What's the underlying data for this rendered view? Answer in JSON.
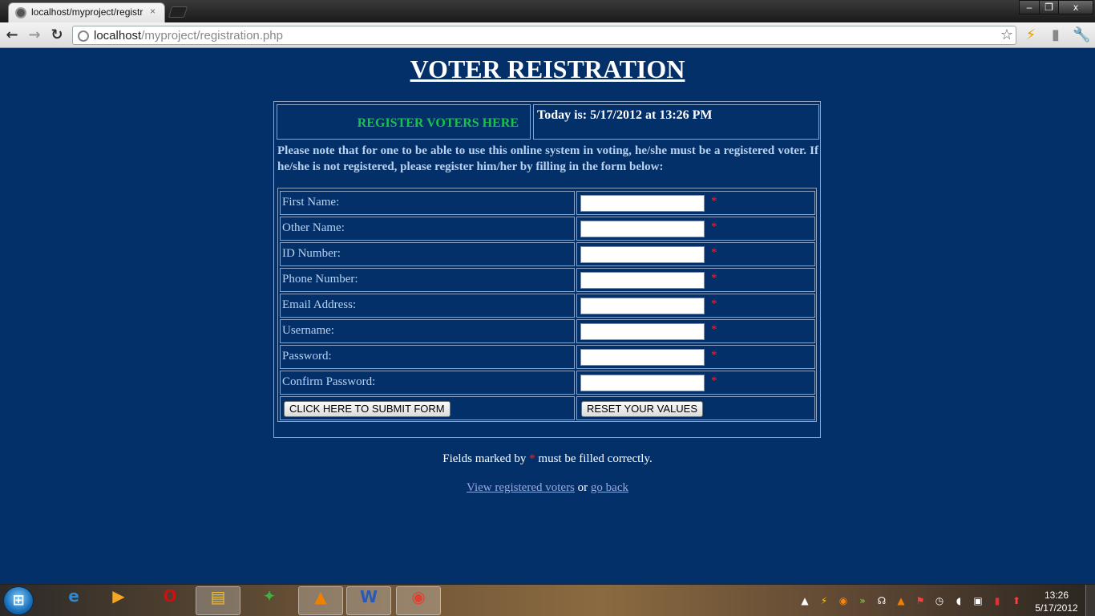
{
  "browser": {
    "tab_title": "localhost/myproject/registr",
    "tab_close": "×",
    "url_host": "localhost",
    "url_path": "/myproject/registration.php",
    "window_buttons": {
      "minimize": "–",
      "maximize": "❐",
      "close": "x"
    }
  },
  "page": {
    "title": "VOTER REISTRATION",
    "register_heading": "REGISTER VOTERS HERE",
    "date_text": "Today is: 5/17/2012 at 13:26 PM",
    "notice": "Please note that for one to be able to use this online system in voting, he/she must be a registered voter. If he/she is not registered, please register him/her by filling in the form below:",
    "fields": [
      {
        "label": "First Name:",
        "value": ""
      },
      {
        "label": "Other Name:",
        "value": ""
      },
      {
        "label": "ID Number:",
        "value": ""
      },
      {
        "label": "Phone Number:",
        "value": ""
      },
      {
        "label": "Email Address:",
        "value": ""
      },
      {
        "label": "Username:",
        "value": ""
      },
      {
        "label": "Password:",
        "value": ""
      },
      {
        "label": "Confirm Password:",
        "value": ""
      }
    ],
    "required_marker": "*",
    "submit_label": "CLICK HERE TO SUBMIT FORM",
    "reset_label": "RESET YOUR VALUES",
    "footnote_before": "Fields marked by",
    "footnote_after": "must be filled correctly.",
    "link_view": "View registered voters",
    "link_sep": "or",
    "link_back": "go back"
  },
  "taskbar": {
    "clock_time": "13:26",
    "clock_date": "5/17/2012"
  },
  "colors": {
    "page_bg": "#04306a",
    "heading_green": "#19c24d",
    "label_blue": "#b9d2ee",
    "required_red": "#ff2020",
    "link": "#9aa8d8"
  }
}
